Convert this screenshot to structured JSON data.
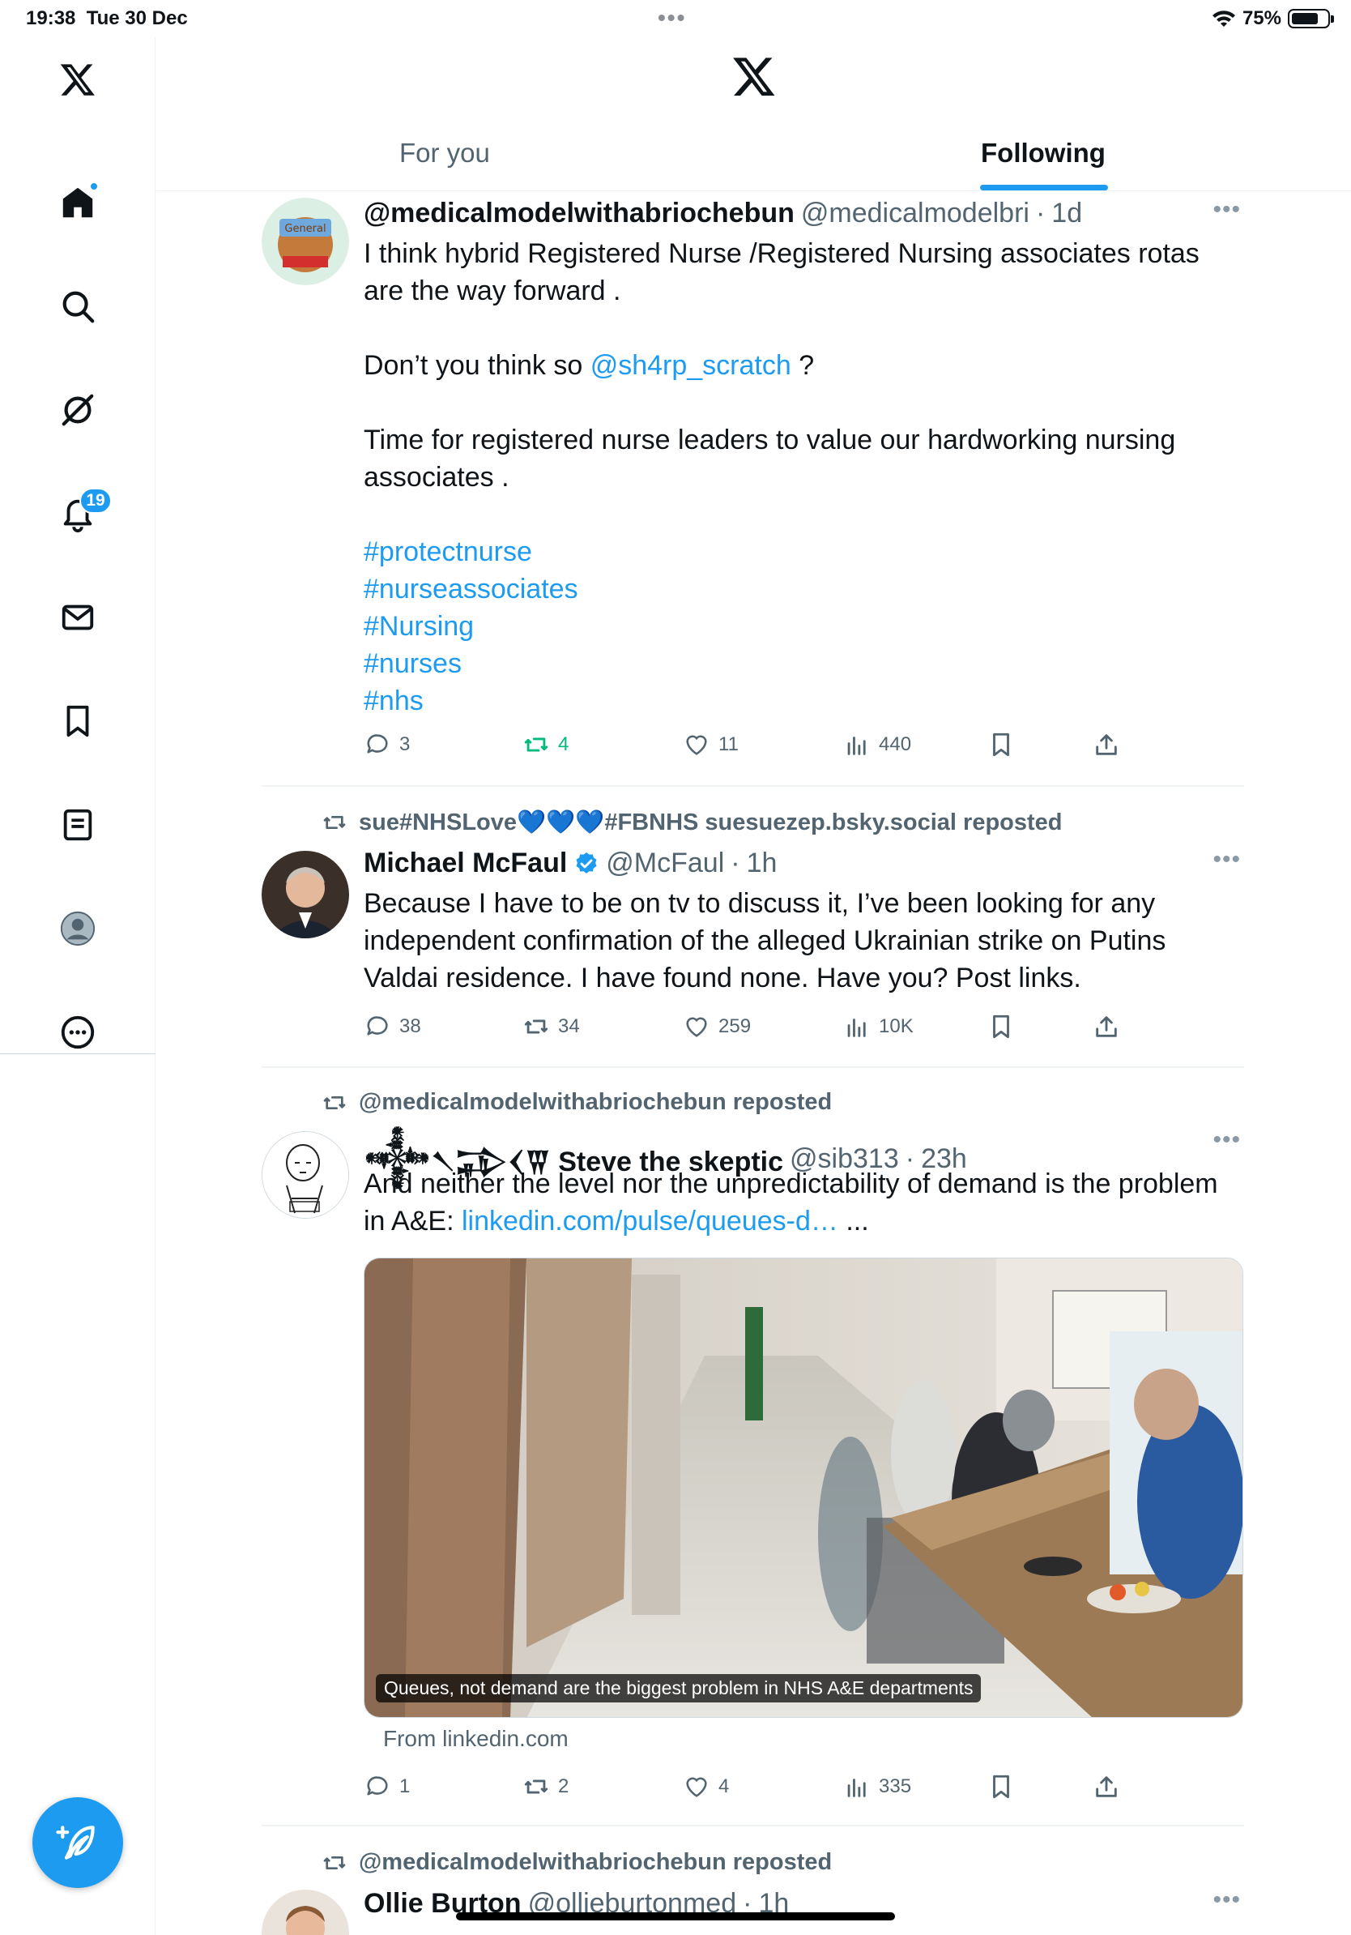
{
  "status_bar": {
    "time": "19:38",
    "date": "Tue 30 Dec",
    "battery": "75%",
    "battery_level": 0.75
  },
  "sidebar": {
    "items": [
      {
        "name": "x-logo-icon"
      },
      {
        "name": "home-icon",
        "active": true
      },
      {
        "name": "search-icon"
      },
      {
        "name": "grok-icon"
      },
      {
        "name": "notifications-icon",
        "badge": "19"
      },
      {
        "name": "messages-icon"
      },
      {
        "name": "bookmarks-icon"
      },
      {
        "name": "lists-icon"
      },
      {
        "name": "profile-icon"
      },
      {
        "name": "more-icon"
      }
    ],
    "compose_icon": "compose-icon"
  },
  "header": {
    "tabs": [
      {
        "label": "For you",
        "active": false
      },
      {
        "label": "Following",
        "active": true
      }
    ]
  },
  "posts": [
    {
      "author": {
        "name": "@medicalmodelwithabriochebun",
        "handle": "@medicalmodelbri",
        "time": "1d"
      },
      "body": {
        "p1": "I think hybrid  Registered Nurse /Registered Nursing associates rotas are the way forward .",
        "p2_pre": "Don’t you think so ",
        "p2_mention": "@sh4rp_scratch",
        "p2_post": " ?",
        "p3": "Time for registered nurse leaders to value our hardworking nursing associates .",
        "hashtags": [
          "#protectnurse",
          "#nurseassociates",
          "#Nursing",
          "#nurses",
          "#nhs"
        ]
      },
      "stats": {
        "replies": "3",
        "reposts": "4",
        "likes": "11",
        "views": "440"
      }
    },
    {
      "repost_by": "sue#NHSLove💙💙💙#FBNHS suesuezep.bsky.social reposted",
      "author": {
        "name": "Michael McFaul",
        "handle": "@McFaul",
        "time": "1h",
        "verified": true
      },
      "body": {
        "text": "Because I have to be on tv to discuss it, I’ve been looking for any independent confirmation of the alleged Ukrainian strike on Putins Valdai residence. I have found none. Have you? Post links."
      },
      "stats": {
        "replies": "38",
        "reposts": "34",
        "likes": "259",
        "views": "10K"
      }
    },
    {
      "repost_by": "@medicalmodelwithabriochebun reposted",
      "author": {
        "name": "𒀱𒀹𒁉𒌋𒐊 Steve the skeptic",
        "handle": "@sib313",
        "time": "23h"
      },
      "body": {
        "text_pre": "And neither the level nor the unpredictability of demand is the problem in A&E: ",
        "link": "linkedin.com/pulse/queues-d…",
        "text_post": " ..."
      },
      "card": {
        "caption": "Queues, not demand are the biggest problem in NHS A&E departments",
        "source": "From linkedin.com"
      },
      "stats": {
        "replies": "1",
        "reposts": "2",
        "likes": "4",
        "views": "335"
      }
    },
    {
      "repost_by": "@medicalmodelwithabriochebun reposted",
      "author": {
        "name": "Ollie Burton",
        "handle": "@ollieburtonmed",
        "time": "1h"
      }
    }
  ]
}
